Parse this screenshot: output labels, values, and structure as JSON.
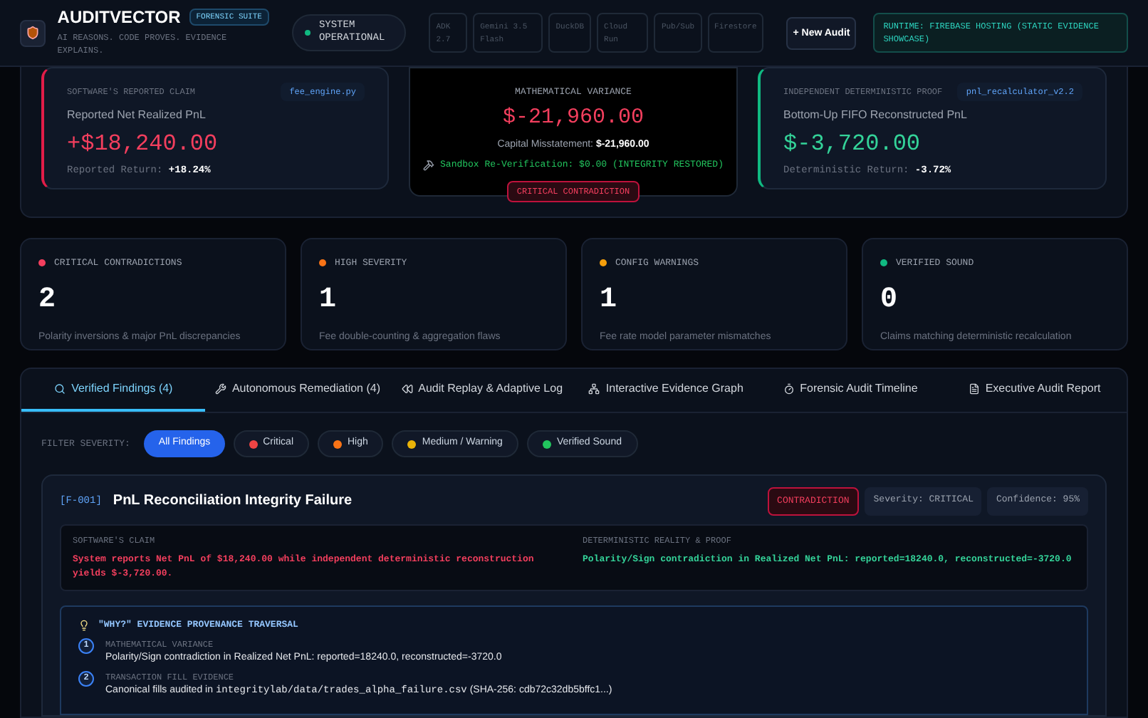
{
  "header": {
    "title": "AUDITVECTOR",
    "badge": "FORENSIC SUITE",
    "tagline": "AI REASONS. CODE PROVES. EVIDENCE EXPLAINS.",
    "status": {
      "label": "SYSTEM OPERATIONAL",
      "color": "#10b981"
    },
    "chips": [
      "ADK 2.7",
      "Gemini 3.5 Flash",
      "DuckDB",
      "Cloud Run",
      "Pub/Sub",
      "Firestore"
    ],
    "new_audit": "+ New Audit",
    "runtime": "RUNTIME: FIREBASE HOSTING (STATIC EVIDENCE SHOWCASE)"
  },
  "proof": {
    "claim": {
      "label": "SOFTWARE'S REPORTED CLAIM",
      "file": "fee_engine.py",
      "caption": "Reported Net Realized PnL",
      "value": "+$18,240.00",
      "footer": "Reported Return: **+18.24%**"
    },
    "variance": {
      "label": "MATHEMATICAL VARIANCE",
      "value": "$-21,960.00",
      "caption": "Capital Misstatement: **$-21,960.00**",
      "sandbox": "Sandbox Re-Verification: $0.00 (INTEGRITY RESTORED)",
      "tag": "CRITICAL CONTRADICTION"
    },
    "reality": {
      "label": "INDEPENDENT DETERMINISTIC PROOF",
      "file": "pnl_recalculator_v2.2",
      "caption": "Bottom-Up FIFO Reconstructed PnL",
      "value": "$-3,720.00",
      "footer": "Deterministic Return: **-3.72%**"
    }
  },
  "stats": [
    {
      "label": "CRITICAL CONTRADICTIONS",
      "value": "2",
      "note": "Polarity inversions & major PnL discrepancies",
      "color": "#f43f5e"
    },
    {
      "label": "HIGH SEVERITY",
      "value": "1",
      "note": "Fee double-counting & aggregation flaws",
      "color": "#f97316"
    },
    {
      "label": "CONFIG WARNINGS",
      "value": "1",
      "note": "Fee rate model parameter mismatches",
      "color": "#f59e0b"
    },
    {
      "label": "VERIFIED SOUND",
      "value": "0",
      "note": "Claims matching deterministic recalculation",
      "color": "#10b981"
    }
  ],
  "tabs": [
    {
      "label": "Verified Findings (4)",
      "kind": "search",
      "selected": true
    },
    {
      "label": "Autonomous Remediation (4)",
      "kind": "tools",
      "selected": false
    },
    {
      "label": "Audit Replay & Adaptive Log",
      "kind": "rewind",
      "selected": false
    },
    {
      "label": "Interactive Evidence Graph",
      "kind": "graph",
      "selected": false
    },
    {
      "label": "Forensic Audit Timeline",
      "kind": "timer",
      "selected": false
    },
    {
      "label": "Executive Audit Report",
      "kind": "report",
      "selected": false
    }
  ],
  "filter": {
    "label": "FILTER SEVERITY:",
    "options": [
      {
        "label": "All Findings",
        "selected": true
      },
      {
        "label": "Critical",
        "color": "#ef4444",
        "selected": false
      },
      {
        "label": "High",
        "color": "#f97316",
        "selected": false
      },
      {
        "label": "Medium / Warning",
        "color": "#eab308",
        "selected": false
      },
      {
        "label": "Verified Sound",
        "color": "#22c55e",
        "selected": false
      }
    ]
  },
  "finding": {
    "id": "[F-001]",
    "title": "PnL Reconciliation Integrity Failure",
    "tags": [
      {
        "label": "CONTRADICTION",
        "kind": "alert"
      },
      {
        "label": "Severity: CRITICAL",
        "kind": "plain"
      },
      {
        "label": "Confidence: 95%",
        "kind": "plain"
      }
    ],
    "claim_label": "SOFTWARE'S CLAIM",
    "claim": "System reports Net PnL of $18,240.00 while independent deterministic reconstruction yields $-3,720.00.",
    "reality_label": "DETERMINISTIC REALITY & PROOF",
    "reality": "Polarity/Sign contradiction in Realized Net PnL: reported=18240.0, reconstructed=-3720.0",
    "provenance": {
      "title": "\"WHY?\" EVIDENCE PROVENANCE TRAVERSAL",
      "steps": [
        {
          "number": "1",
          "label": "MATHEMATICAL VARIANCE",
          "parts": [
            {
              "kind": "text",
              "text": "Polarity/Sign contradiction in Realized Net PnL: reported=18240.0, reconstructed=-3720.0"
            }
          ]
        },
        {
          "number": "2",
          "label": "TRANSACTION FILL EVIDENCE",
          "parts": [
            {
              "kind": "text",
              "text": "Canonical fills audited in "
            },
            {
              "kind": "code",
              "text": "integritylab/data/trades_alpha_failure.csv"
            },
            {
              "kind": "text",
              "text": " (SHA-256: cdb72c32db5bffc1...)"
            }
          ]
        }
      ]
    }
  }
}
